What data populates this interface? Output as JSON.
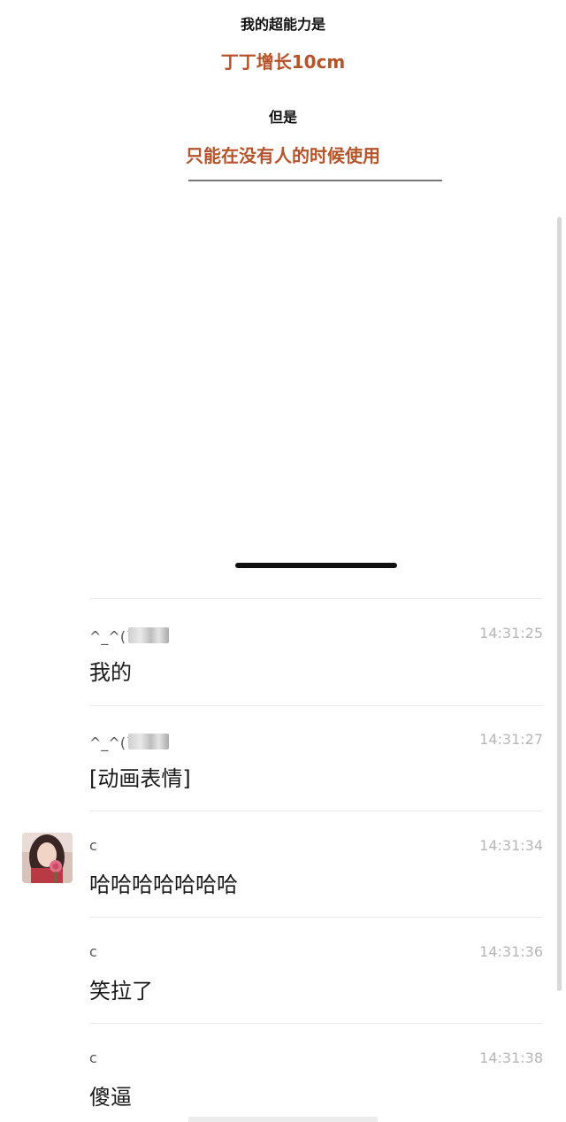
{
  "header": {
    "line1": "我的超能力是",
    "line2": "丁丁增长10cm",
    "line3": "但是",
    "line4": "只能在没有人的时候使用"
  },
  "messages": [
    {
      "sender": "^_^(ㄋ",
      "time": "14:31:25",
      "text": "我的"
    },
    {
      "sender": "^_^(ㄋ",
      "time": "14:31:27",
      "text": "[动画表情]"
    },
    {
      "sender": "c",
      "time": "14:31:34",
      "text": "哈哈哈哈哈哈哈"
    },
    {
      "sender": "c",
      "time": "14:31:36",
      "text": "笑拉了"
    },
    {
      "sender": "c",
      "time": "14:31:38",
      "text": "傻逼"
    }
  ],
  "colors": {
    "accent_orange": "#b5532a",
    "time_gray": "#b6b6b6"
  }
}
